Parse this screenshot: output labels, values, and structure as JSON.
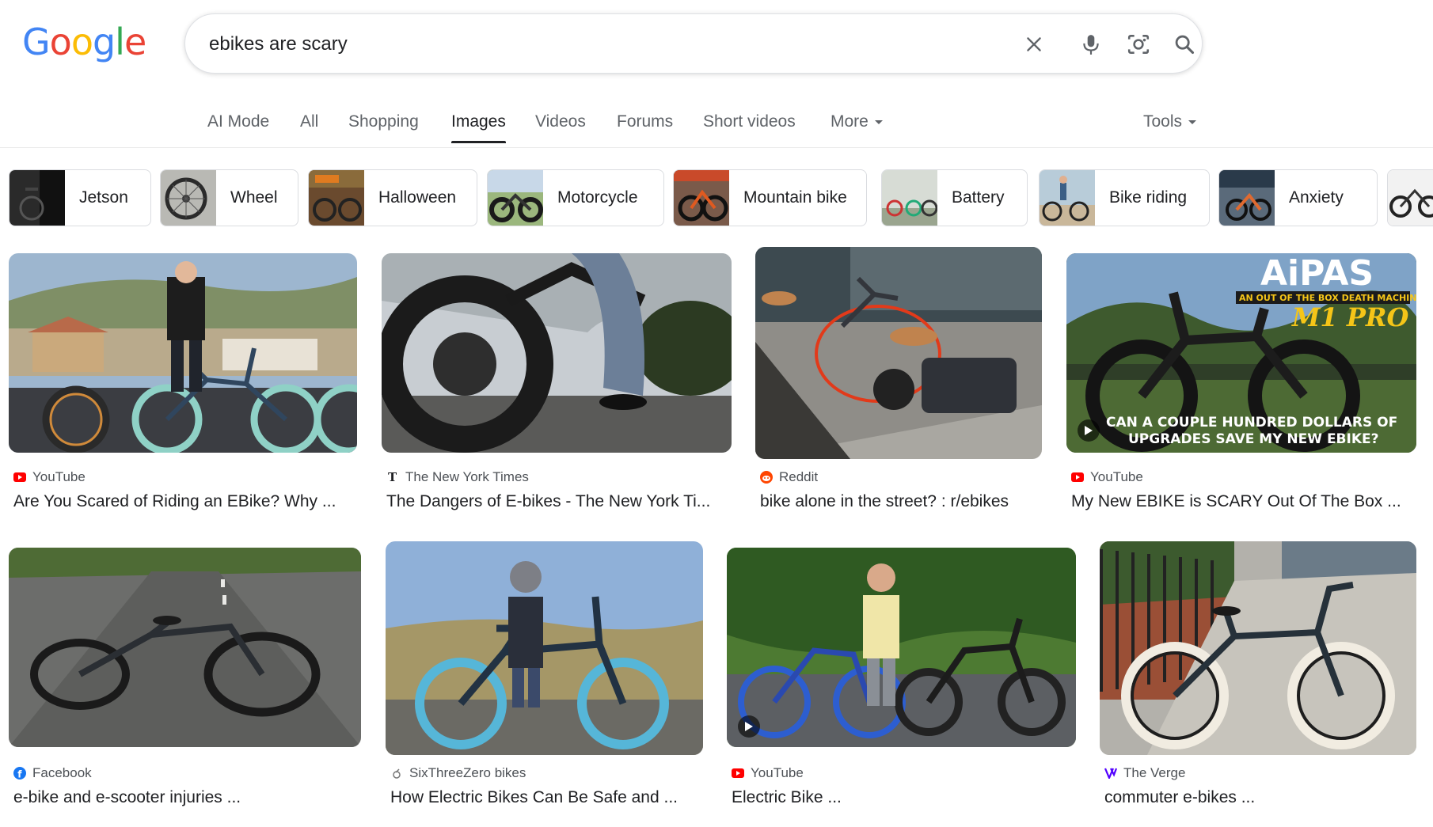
{
  "logo": {
    "text": "Google",
    "colors": [
      "#4285F4",
      "#EA4335",
      "#FBBC05",
      "#4285F4",
      "#34A853",
      "#EA4335"
    ]
  },
  "search": {
    "query": "ebikes are scary",
    "icons": [
      "close-icon",
      "microphone-icon",
      "lens-camera-icon",
      "search-icon"
    ]
  },
  "tabs": [
    {
      "label": "AI Mode"
    },
    {
      "label": "All"
    },
    {
      "label": "Shopping"
    },
    {
      "label": "Images",
      "active": true
    },
    {
      "label": "Videos"
    },
    {
      "label": "Forums"
    },
    {
      "label": "Short videos"
    },
    {
      "label": "More"
    }
  ],
  "tools_label": "Tools",
  "chips": [
    {
      "label": "Jetson"
    },
    {
      "label": "Wheel"
    },
    {
      "label": "Halloween"
    },
    {
      "label": "Motorcycle"
    },
    {
      "label": "Mountain bike"
    },
    {
      "label": "Battery"
    },
    {
      "label": "Bike riding"
    },
    {
      "label": "Anxiety"
    }
  ],
  "results": [
    {
      "source": "YouTube",
      "source_icon": "youtube-icon",
      "title": "Are You Scared of Riding an EBike? Why ...",
      "video": false
    },
    {
      "source": "The New York Times",
      "source_icon": "nyt-icon",
      "title": "The Dangers of E-bikes - The New York Ti...",
      "video": false
    },
    {
      "source": "Reddit",
      "source_icon": "reddit-icon",
      "title": "bike alone in the street? : r/ebikes",
      "video": false
    },
    {
      "source": "YouTube",
      "source_icon": "youtube-icon",
      "title": "My New EBIKE is SCARY Out Of The Box ...",
      "video": true,
      "overlay": {
        "brand": "AiPAS",
        "tagline": "AN OUT OF THE BOX DEATH MACHINE?",
        "model": "M1 PRO",
        "caption_line1": "CAN A COUPLE HUNDRED DOLLARS OF",
        "caption_line2": "UPGRADES SAVE MY NEW EBIKE?"
      }
    },
    {
      "source": "Facebook",
      "source_icon": "facebook-icon",
      "title": "e-bike and e-scooter injuries ...",
      "video": false
    },
    {
      "source": "SixThreeZero bikes",
      "source_icon": "sixthreezero-icon",
      "title": "How Electric Bikes Can Be Safe and ...",
      "video": false
    },
    {
      "source": "YouTube",
      "source_icon": "youtube-icon",
      "title": "Electric Bike ...",
      "video": true
    },
    {
      "source": "The Verge",
      "source_icon": "verge-icon",
      "title": "commuter e-bikes ...",
      "video": false
    }
  ]
}
